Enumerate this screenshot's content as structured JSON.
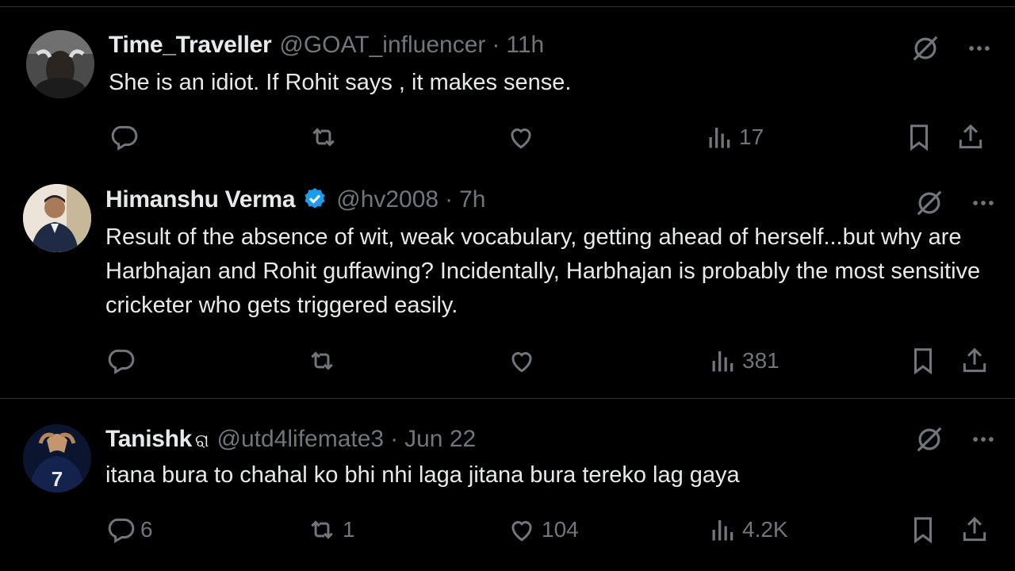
{
  "tweets": [
    {
      "name": "Time_Traveller",
      "handle": "@GOAT_influencer",
      "sep": "·",
      "time": "11h",
      "text": "She is an idiot. If Rohit says , it makes sense.",
      "verified": false,
      "stats": {
        "replies": "",
        "retweets": "",
        "likes": "",
        "views": "17"
      }
    },
    {
      "name": "Himanshu Verma",
      "handle": "@hv2008",
      "sep": "·",
      "time": "7h",
      "text": "Result of the absence of wit, weak vocabulary, getting ahead of herself...but why are Harbhajan and Rohit guffawing? Incidentally, Harbhajan is probably the most sensitive cricketer who gets triggered easily.",
      "verified": true,
      "stats": {
        "replies": "",
        "retweets": "",
        "likes": "",
        "views": "381"
      }
    },
    {
      "name": "Tanishk",
      "name_emoji": "ରା",
      "handle": "@utd4lifemate3",
      "sep": "·",
      "time": "Jun 22",
      "text": "itana bura to chahal ko bhi nhi laga jitana bura tereko lag gaya",
      "verified": false,
      "stats": {
        "replies": "6",
        "retweets": "1",
        "likes": "104",
        "views": "4.2K"
      }
    }
  ],
  "colors": {
    "background": "#000000",
    "text": "#e7e9ea",
    "muted": "#71767b",
    "verified": "#1d9bf0",
    "divider": "#2f3336"
  },
  "icons": [
    "grok-slash-icon",
    "more-icon",
    "reply-icon",
    "retweet-icon",
    "like-icon",
    "views-icon",
    "bookmark-icon",
    "share-icon",
    "verified-badge-icon"
  ]
}
